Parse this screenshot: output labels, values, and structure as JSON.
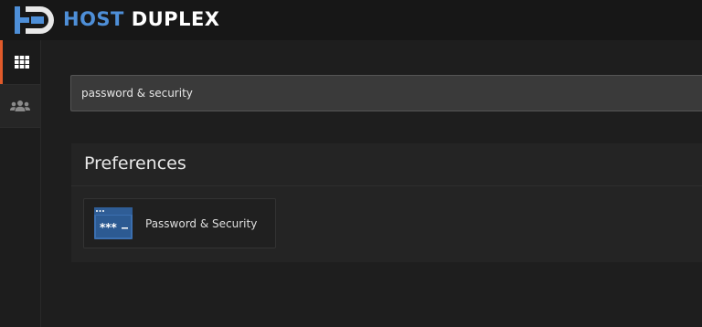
{
  "brand": {
    "name_part1": "HOST",
    "name_part2": "DUPLEX",
    "logo_icon": "hd-logo-icon",
    "primary_color": "#4e8fd8"
  },
  "sidebar": {
    "items": [
      {
        "icon": "grid-icon",
        "active": true,
        "accent": "#e05a2a"
      },
      {
        "icon": "users-icon",
        "active": false
      }
    ]
  },
  "search": {
    "value": "password & security"
  },
  "panel": {
    "title": "Preferences",
    "items": [
      {
        "label": "Password & Security",
        "icon": "password-window-icon",
        "icon_text": "***"
      }
    ]
  }
}
